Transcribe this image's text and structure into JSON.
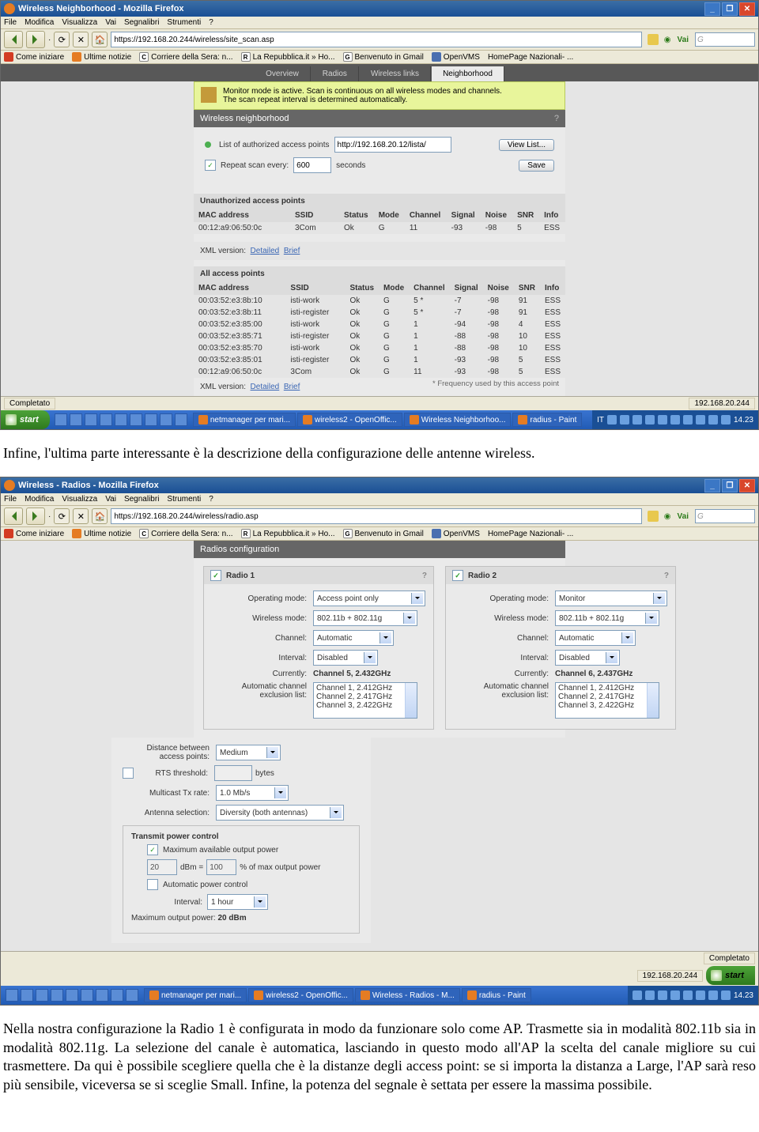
{
  "s1": {
    "title": "Wireless Neighborhood - Mozilla Firefox",
    "menu": [
      "File",
      "Modifica",
      "Visualizza",
      "Vai",
      "Segnalibri",
      "Strumenti",
      "?"
    ],
    "url": "https://192.168.20.244/wireless/site_scan.asp",
    "go": "Vai",
    "search_hint": "G",
    "bookmarks": [
      "Come iniziare",
      "Ultime notizie",
      "Corriere della Sera: n...",
      "La Repubblica.it » Ho...",
      "Benvenuto in Gmail",
      "OpenVMS",
      "HomePage Nazionali- ..."
    ],
    "tabs": [
      "Overview",
      "Radios",
      "Wireless links",
      "Neighborhood"
    ],
    "warn1": "Monitor mode is active. Scan is continuous on all wireless modes and channels.",
    "warn2": "The scan repeat interval is determined automatically.",
    "panel_title": "Wireless neighborhood",
    "list_label": "List of authorized access points",
    "list_url": "http://192.168.20.12/lista/",
    "viewlist": "View List...",
    "repeat_label": "Repeat scan every:",
    "repeat_val": "600",
    "seconds": "seconds",
    "save": "Save",
    "sect_unauth": "Unauthorized access points",
    "cols": [
      "MAC address",
      "SSID",
      "Status",
      "Mode",
      "Channel",
      "Signal",
      "Noise",
      "SNR",
      "Info"
    ],
    "row_unauth": [
      "00:12:a9:06:50:0c",
      "3Com",
      "Ok",
      "G",
      "11",
      "-93",
      "-98",
      "5",
      "ESS"
    ],
    "xml_label": "XML version:",
    "xml_detailed": "Detailed",
    "xml_brief": "Brief",
    "sect_all": "All access points",
    "rows_all": [
      [
        "00:03:52:e3:8b:10",
        "isti-work",
        "Ok",
        "G",
        "5 *",
        "-7",
        "-98",
        "91",
        "ESS"
      ],
      [
        "00:03:52:e3:8b:11",
        "isti-register",
        "Ok",
        "G",
        "5 *",
        "-7",
        "-98",
        "91",
        "ESS"
      ],
      [
        "00:03:52:e3:85:00",
        "isti-work",
        "Ok",
        "G",
        "1",
        "-94",
        "-98",
        "4",
        "ESS"
      ],
      [
        "00:03:52:e3:85:71",
        "isti-register",
        "Ok",
        "G",
        "1",
        "-88",
        "-98",
        "10",
        "ESS"
      ],
      [
        "00:03:52:e3:85:70",
        "isti-work",
        "Ok",
        "G",
        "1",
        "-88",
        "-98",
        "10",
        "ESS"
      ],
      [
        "00:03:52:e3:85:01",
        "isti-register",
        "Ok",
        "G",
        "1",
        "-93",
        "-98",
        "5",
        "ESS"
      ],
      [
        "00:12:a9:06:50:0c",
        "3Com",
        "Ok",
        "G",
        "11",
        "-93",
        "-98",
        "5",
        "ESS"
      ]
    ],
    "freq_note": "* Frequency used by this access point",
    "status": "Completato",
    "ip": "192.168.20.244",
    "start": "start",
    "tasks": [
      "netmanager per mari...",
      "wireless2 - OpenOffic...",
      "Wireless Neighborhoo...",
      "radius - Paint"
    ],
    "lang": "IT",
    "clock": "14.23"
  },
  "para1": "Infine, l'ultima parte interessante è la descrizione della configurazione delle antenne wireless.",
  "s2": {
    "title": "Wireless - Radios - Mozilla Firefox",
    "menu": [
      "File",
      "Modifica",
      "Visualizza",
      "Vai",
      "Segnalibri",
      "Strumenti",
      "?"
    ],
    "url": "https://192.168.20.244/wireless/radio.asp",
    "go": "Vai",
    "bookmarks": [
      "Come iniziare",
      "Ultime notizie",
      "Corriere della Sera: n...",
      "La Repubblica.it » Ho...",
      "Benvenuto in Gmail",
      "OpenVMS",
      "HomePage Nazionali- ..."
    ],
    "panel_title": "Radios configuration",
    "r1_title": "Radio 1",
    "r2_title": "Radio 2",
    "op_mode": "Operating mode:",
    "r1_op": "Access point only",
    "r2_op": "Monitor",
    "wl_mode": "Wireless mode:",
    "wl_val": "802.11b + 802.11g",
    "channel": "Channel:",
    "ch_val": "Automatic",
    "interval": "Interval:",
    "int_val": "Disabled",
    "currently": "Currently:",
    "r1_cur": "Channel 5, 2.432GHz",
    "r2_cur": "Channel 6, 2.437GHz",
    "excl": "Automatic channel exclusion list:",
    "excl_items": [
      "Channel 1, 2.412GHz",
      "Channel 2, 2.417GHz",
      "Channel 3, 2.422GHz"
    ],
    "dist": "Distance between access points:",
    "dist_val": "Medium",
    "rts": "RTS threshold:",
    "bytes": "bytes",
    "mcast": "Multicast Tx rate:",
    "mcast_val": "1.0 Mb/s",
    "ant": "Antenna selection:",
    "ant_val": "Diversity (both antennas)",
    "tpc": "Transmit power control",
    "max_out": "Maximum available output power",
    "dbm_val": "20",
    "dbm": "dBm =",
    "pct_val": "100",
    "pct": "% of max output power",
    "auto_pc": "Automatic power control",
    "int2": "Interval:",
    "int2_val": "1 hour",
    "max_pow": "Maximum output power:",
    "max_pow_val": "20 dBm",
    "status": "Completato",
    "ip": "192.168.20.244",
    "start": "start",
    "tasks": [
      "netmanager per mari...",
      "wireless2 - OpenOffic...",
      "Wireless - Radios - M...",
      "radius - Paint"
    ],
    "clock": "14.23"
  },
  "para2": "Nella nostra configurazione la Radio 1 è configurata in modo da funzionare solo come AP. Trasmette sia in modalità 802.11b sia in modalità 802.11g. La selezione del canale è automatica, lasciando in questo modo all'AP la scelta del canale migliore su cui trasmettere. Da qui è possibile scegliere quella che è la distanze degli access point: se si importa la distanza a Large, l'AP sarà reso più sensibile, viceversa se si sceglie Small. Infine, la potenza del segnale è settata per essere la massima possibile."
}
